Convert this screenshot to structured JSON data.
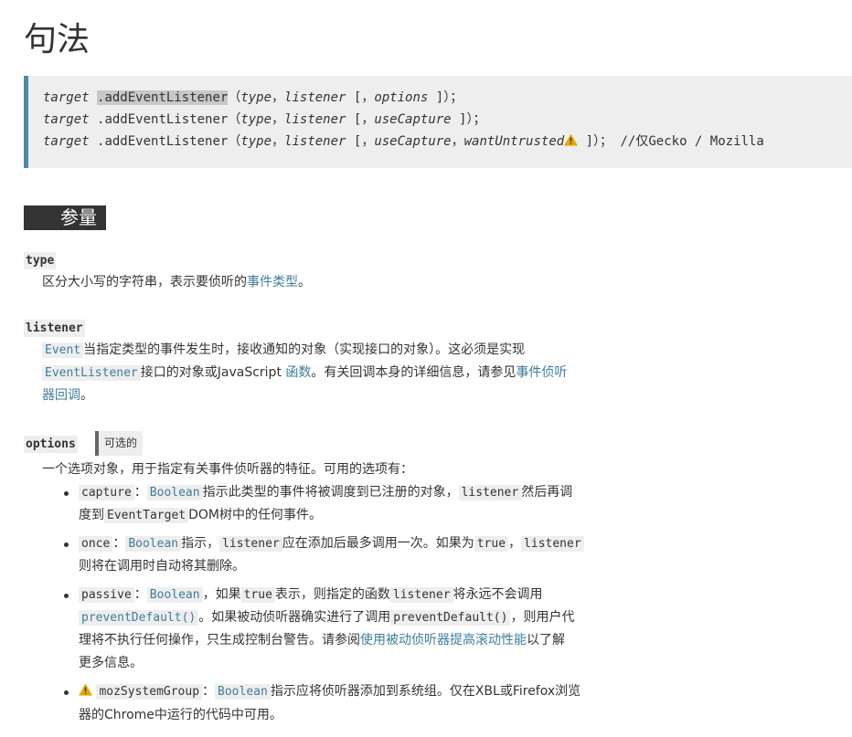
{
  "heading": "句法",
  "syntax": {
    "lines": [
      {
        "target": "target",
        "method": ".addEventListener",
        "open": "（",
        "p1": "type",
        "sep1": "，",
        "p2": "listener",
        "bracket": " [，",
        "p3": "options",
        "close": " ]）；",
        "extra": ""
      },
      {
        "target": "target",
        "method": ".addEventListener",
        "open": "（",
        "p1": "type",
        "sep1": "，",
        "p2": "listener",
        "bracket": " [，",
        "p3": "useCapture",
        "close": " ]）；",
        "extra": ""
      },
      {
        "target": "target",
        "method": ".addEventListener",
        "open": "（",
        "p1": "type",
        "sep1": "，",
        "p2": "listener",
        "bracket": " [，",
        "p3": "useCapture",
        "sep3": "，",
        "p4": "wantUntrusted",
        "close": " ]）；",
        "extra": " //仅Gecko / Mozilla"
      }
    ]
  },
  "params_heading": "参量",
  "type": {
    "term": "type",
    "text": "区分大小写的字符串，表示要侦听的",
    "link": "事件类型",
    "end": "。"
  },
  "listener": {
    "term": "listener",
    "code1": "Event",
    "t1": "当指定类型的事件发生时，接收通知的对象（实现接口的对象）。这必须是实现",
    "code2": "EventListener",
    "t2": "接口的对象或JavaScript ",
    "link1": "函数",
    "t3": "。有关回调本身的详细信息，请参见",
    "link2a": "事件侦听",
    "link2b": "器回调",
    "t4": "。"
  },
  "options": {
    "term": "options",
    "optional": "可选的",
    "intro": "一个选项对象，用于指定有关事件侦听器的特征。可用的选项有：",
    "capture": {
      "code": "capture",
      "colon": "：",
      "type": "Boolean",
      "t1": "指示此类型的事件将被调度到已注册的对象，",
      "code2": "listener",
      "t2": "然后再调",
      "t3": "度到",
      "code3": "EventTarget",
      "t4": "DOM树中的任何事件。"
    },
    "once": {
      "code": "once",
      "colon": "：",
      "type": "Boolean",
      "t1": "指示，",
      "code2": "listener",
      "t2": "应在添加后最多调用一次。如果为",
      "code3": "true",
      "t3": "，",
      "code4": "listener",
      "t4": "则将在调用时自动将其删除。"
    },
    "passive": {
      "code": "passive",
      "colon": "：",
      "type": "Boolean",
      "t1": "，如果",
      "code2": "true",
      "t2": "表示，则指定的函数",
      "code3": "listener",
      "t3": "将永远不会调用",
      "code4": "preventDefault()",
      "t4": "。如果被动侦听器确实进行了调用",
      "code5": "preventDefault()",
      "t5": "，则用户代",
      "t6": "理将不执行任何操作，只生成控制台警告。请参阅",
      "link": "使用被动侦听器提高滚动性能",
      "t7": "以了解",
      "t8": "更多信息。"
    },
    "mozSystemGroup": {
      "code": "mozSystemGroup",
      "colon": "：",
      "type": "Boolean",
      "t1": "指示应将侦听器添加到系统组。仅在XBL或Firefox浏览",
      "t2": "器的Chrome中运行的代码中可用。"
    }
  }
}
